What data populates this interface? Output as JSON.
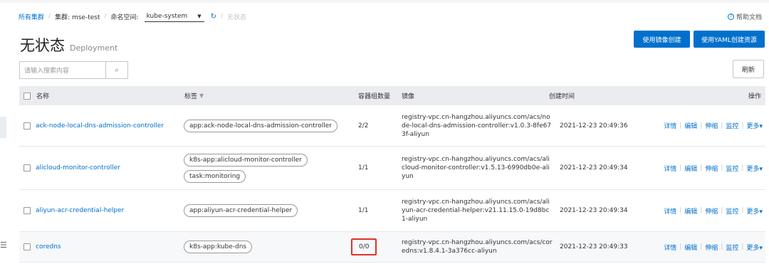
{
  "breadcrumb": {
    "all_clusters": "所有集群",
    "cluster": "集群: mse-test",
    "namespace_label": "命名空间:",
    "namespace_value": "kube-system",
    "current": "无状态"
  },
  "help_doc": "帮助文档",
  "page": {
    "title": "无状态",
    "subtitle": "Deployment"
  },
  "actions": {
    "create_by_image": "使用镜像创建",
    "create_by_yaml": "使用YAML创建资源",
    "refresh": "刷新"
  },
  "search": {
    "placeholder": "请输入搜索内容"
  },
  "table": {
    "headers": {
      "name": "名称",
      "tags": "标签",
      "pods": "容器组数量",
      "image": "镜像",
      "created": "创建时间",
      "ops": "操作"
    },
    "rows": [
      {
        "name": "ack-node-local-dns-admission-controller",
        "tags": [
          "app:ack-node-local-dns-admission-controller"
        ],
        "pods": "2/2",
        "image": "registry-vpc.cn-hangzhou.aliyuncs.com/acs/node-local-dns-admission-controller:v1.0.3-8fe673f-aliyun",
        "created": "2021-12-23 20:49:36"
      },
      {
        "name": "alicloud-monitor-controller",
        "tags": [
          "k8s-app:alicloud-monitor-controller",
          "task:monitoring"
        ],
        "pods": "1/1",
        "image": "registry-vpc.cn-hangzhou.aliyuncs.com/acs/alicloud-monitor-controller:v1.5.13-6990db0e-aliyun",
        "created": "2021-12-23 20:49:34"
      },
      {
        "name": "aliyun-acr-credential-helper",
        "tags": [
          "app:aliyun-acr-credential-helper"
        ],
        "pods": "1/1",
        "image": "registry-vpc.cn-hangzhou.aliyuncs.com/acs/aliyun-acr-credential-helper:v21.11.15.0-19d8bc1-aliyun",
        "created": "2021-12-23 20:49:34"
      },
      {
        "name": "coredns",
        "tags": [
          "k8s-app:kube-dns"
        ],
        "pods": "0/0",
        "image": "registry-vpc.cn-hangzhou.aliyuncs.com/acs/coredns:v1.8.4.1-3a376cc-aliyun",
        "created": "2021-12-23 20:49:33"
      }
    ],
    "ops": {
      "detail": "详情",
      "edit": "编辑",
      "scale": "伸缩",
      "monitor": "监控",
      "more": "更多▾"
    }
  },
  "colors": {
    "primary": "#0070cc",
    "highlight_border": "#e0322b"
  }
}
